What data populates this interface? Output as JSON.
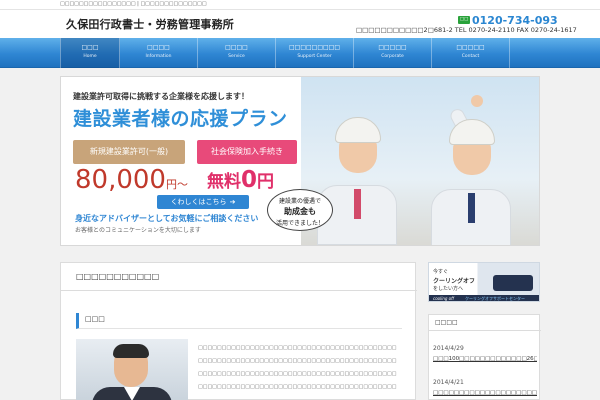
{
  "topbar": {
    "text": "□□□□□□□□□□□□□□□□ | □□□□□□□□□□□□□□"
  },
  "header": {
    "site_title": "久保田行政書士・労務管理事務所",
    "free_badge": "□□",
    "phone": "0120-734-093",
    "address": "□□□□□□□□□□□2□681-2 TEL 0270-24-2110 FAX 0270-24-1617"
  },
  "nav": {
    "items": [
      {
        "jp": "□□□",
        "en": "Home"
      },
      {
        "jp": "□□□□",
        "en": "Information"
      },
      {
        "jp": "□□□□",
        "en": "Service"
      },
      {
        "jp": "□□□□□□□□□",
        "en": "Support Center"
      },
      {
        "jp": "□□□□□",
        "en": "Corporate"
      },
      {
        "jp": "□□□□□",
        "en": "Contact"
      }
    ]
  },
  "banner": {
    "lead": "建設業許可取得に挑戦する企業様を応援します！",
    "title": "建設業者様の応援プラン",
    "pill_a": "新規建設業許可(一般)",
    "pill_b": "社会保険加入手続き",
    "price": "80,000",
    "price_unit": "円〜",
    "free_prefix": "無料",
    "free_value": "0",
    "free_unit": "円",
    "detail_button": "くわしくはこちら",
    "detail_arrow": "➔",
    "sub": "身近なアドバイザーとしてお気軽にご相談ください",
    "sub2": "お客様とのコミュニケーションを大切にします",
    "bubble_l1": "建設業の優遇で",
    "bubble_l2": "助成金も",
    "bubble_l3": "活用できました！"
  },
  "main": {
    "heading": "□□□□□□□□□□□",
    "greeting_title": "□□□",
    "body_lines": [
      "□□□□□□□□□□□□□□□□□□□□□□□□□□□□□□□□□□□□□□□□□□",
      "□□□□□□□□□□□□□□□□□□□□□□□□□□□□□□□□□□□□□□□□□□",
      "□□□□□□□□□□□□□□□□□□□□□□□□□□□□□□□□□□□□□□□□□□",
      "□□□□□□□□□□□□□□□□□□□□□□□□□□□□□□□□□□□□□□□□□□"
    ]
  },
  "sidebar": {
    "banner_t1": "今すぐ",
    "banner_t2": "クーリングオフ",
    "banner_t3": "をしたい方へ",
    "banner_foot_en": "cooling off",
    "banner_foot_jp": "クーリングオフサポートセンター",
    "news_heading": "□□□□",
    "news": [
      {
        "date": "2014/4/29",
        "text": "□□□100□□□□□□□□□□□□□26□□□□□□□□"
      },
      {
        "date": "2014/4/21",
        "text": "□□□□□□□□□□□□□□□□□□□□□□□□□"
      }
    ]
  }
}
